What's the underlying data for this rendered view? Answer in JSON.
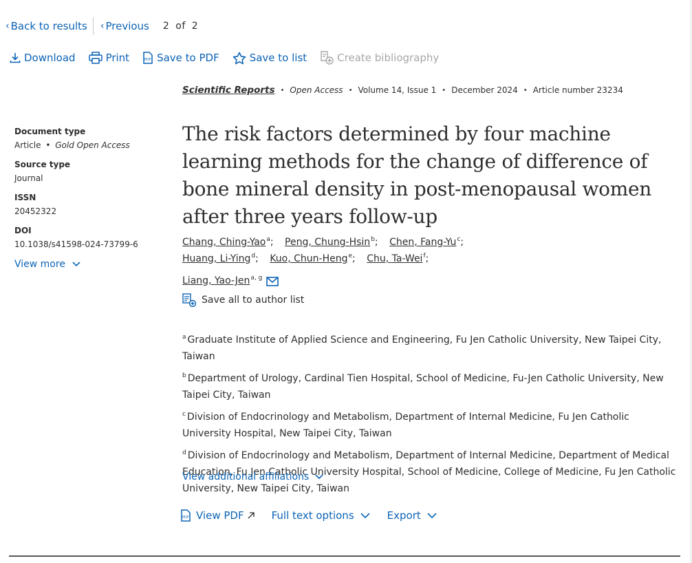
{
  "nav": {
    "back_label": "Back to results",
    "previous_label": "Previous",
    "page_current": "2",
    "page_of": "of",
    "page_total": "2"
  },
  "toolbar": {
    "download": "Download",
    "print": "Print",
    "save_pdf": "Save to PDF",
    "save_list": "Save to list",
    "create_bib": "Create bibliography"
  },
  "journal": {
    "name": "Scientific Reports",
    "access": "Open Access",
    "volume": "Volume 14, Issue 1",
    "date": "December 2024",
    "article_number": "Article number 23234"
  },
  "title": "The risk factors determined by four machine learning methods for the change of difference of bone mineral density in post-menopausal women after three years follow-up",
  "authors": [
    {
      "name": "Chang, Ching-Yao",
      "sup": "a",
      "punct": ";"
    },
    {
      "name": "Peng, Chung-Hsin",
      "sup": "b",
      "punct": ";"
    },
    {
      "name": "Chen, Fang-Yu",
      "sup": "c",
      "punct": ";"
    },
    {
      "name": "Huang, Li-Ying",
      "sup": "d",
      "punct": ";"
    },
    {
      "name": "Kuo, Chun-Heng",
      "sup": "e",
      "punct": ";"
    },
    {
      "name": "Chu, Ta-Wei",
      "sup": "f",
      "punct": ";"
    },
    {
      "name": "Liang, Yao-Jen",
      "sup": "a, g",
      "punct": ""
    }
  ],
  "save_authors_label": "Save all to author list",
  "affiliations": [
    {
      "sup": "a",
      "text": "Graduate Institute of Applied Science and Engineering, Fu Jen Catholic University, New Taipei City, Taiwan"
    },
    {
      "sup": "b",
      "text": "Department of Urology, Cardinal Tien Hospital, School of Medicine, Fu-Jen Catholic University, New Taipei City, Taiwan"
    },
    {
      "sup": "c",
      "text": "Division of Endocrinology and Metabolism, Department of Internal Medicine, Fu Jen Catholic University Hospital, New Taipei City, Taiwan"
    },
    {
      "sup": "d",
      "text": "Division of Endocrinology and Metabolism, Department of Internal Medicine, Department of Medical Education, Fu Jen Catholic University Hospital, School of Medicine, College of Medicine, Fu Jen Catholic University, New Taipei City, Taiwan"
    }
  ],
  "view_more_affils": "View additional affiliations",
  "sidebar": {
    "doc_type_label": "Document type",
    "doc_type_value": "Article",
    "doc_access": "Gold Open Access",
    "source_type_label": "Source type",
    "source_type_value": "Journal",
    "issn_label": "ISSN",
    "issn_value": "20452322",
    "doi_label": "DOI",
    "doi_value": "10.1038/s41598-024-73799-6",
    "view_more": "View more"
  },
  "actions": {
    "view_pdf": "View PDF",
    "full_text": "Full text options",
    "export": "Export"
  },
  "colors": {
    "link": "#0c63b5",
    "text": "#2e2e2e",
    "disabled": "#a7a7a7"
  }
}
